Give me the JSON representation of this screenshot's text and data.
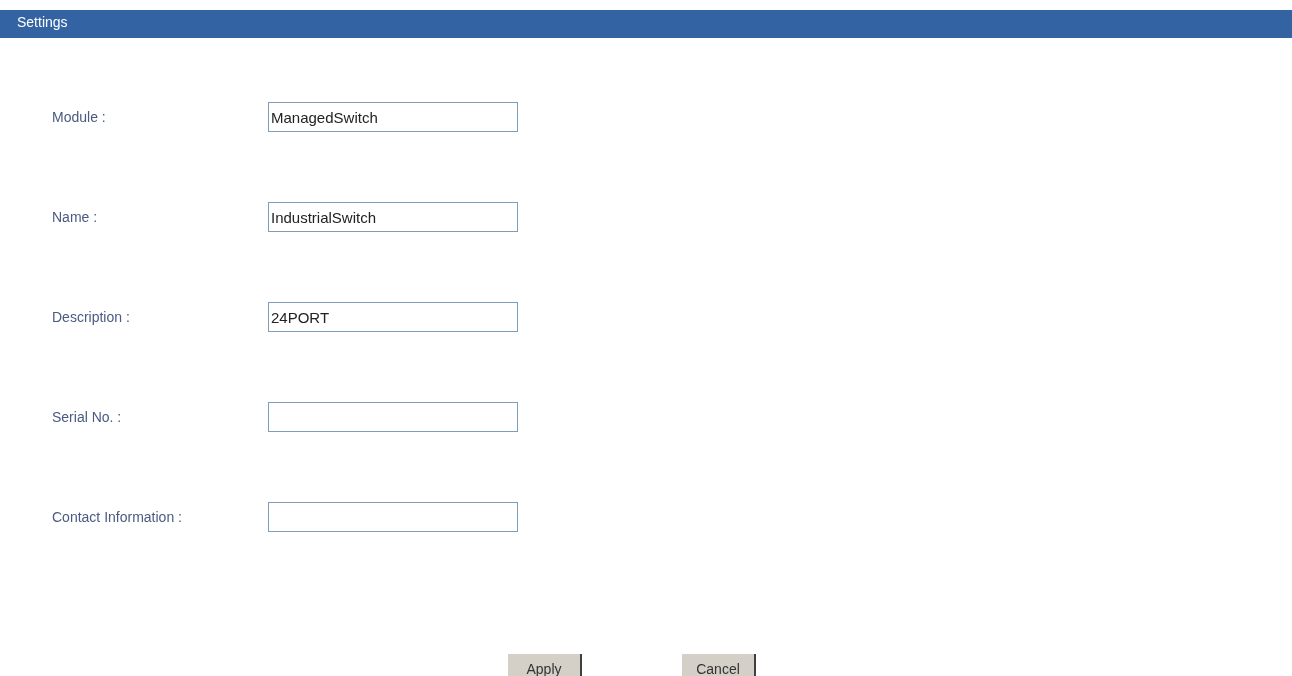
{
  "header": {
    "title": "Settings"
  },
  "fields": [
    {
      "label": "Module :",
      "value": "ManagedSwitch"
    },
    {
      "label": "Name :",
      "value": "IndustrialSwitch"
    },
    {
      "label": "Description :",
      "value": "24PORT"
    },
    {
      "label": "Serial No. :"
    },
    {
      "label": "Contact Information :"
    }
  ],
  "buttons": [
    "Apply",
    "Cancel"
  ]
}
